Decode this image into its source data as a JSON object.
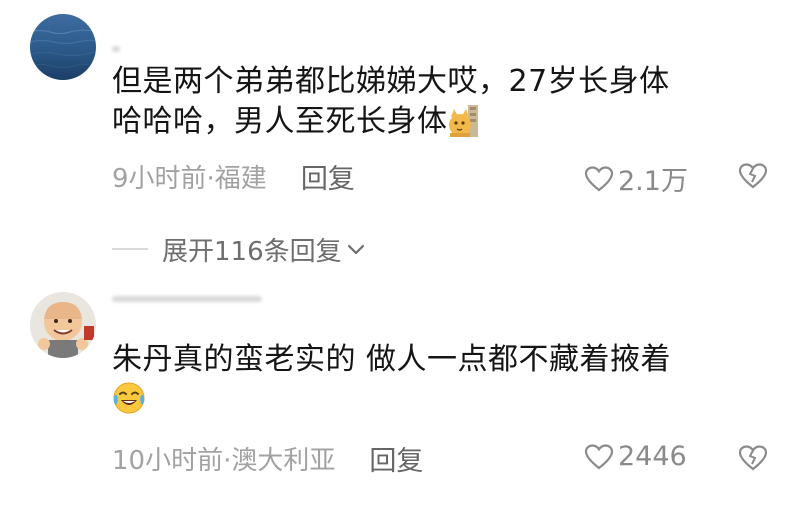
{
  "comments": [
    {
      "text_line1": "但是两个弟弟都比娣娣大哎，27岁长身体",
      "text_line2": "哈哈哈，男人至死长身体",
      "emoji_icon": "cat-emoji-icon",
      "time": "9小时前",
      "location": "·福建",
      "reply_label": "回复",
      "likes": "2.1万"
    },
    {
      "text_line1": "朱丹真的蛮老实的 做人一点都不藏着掖着",
      "emoji_icon": "laughing-crying-emoji-icon",
      "time": "10小时前",
      "location": "·澳大利亚",
      "reply_label": "回复",
      "likes": "2446"
    }
  ],
  "expand_replies": {
    "label": "展开116条回复"
  },
  "colors": {
    "text": "#151515",
    "meta": "#a2a2a2",
    "reply": "#666666",
    "expand": "#6e6e6e"
  }
}
